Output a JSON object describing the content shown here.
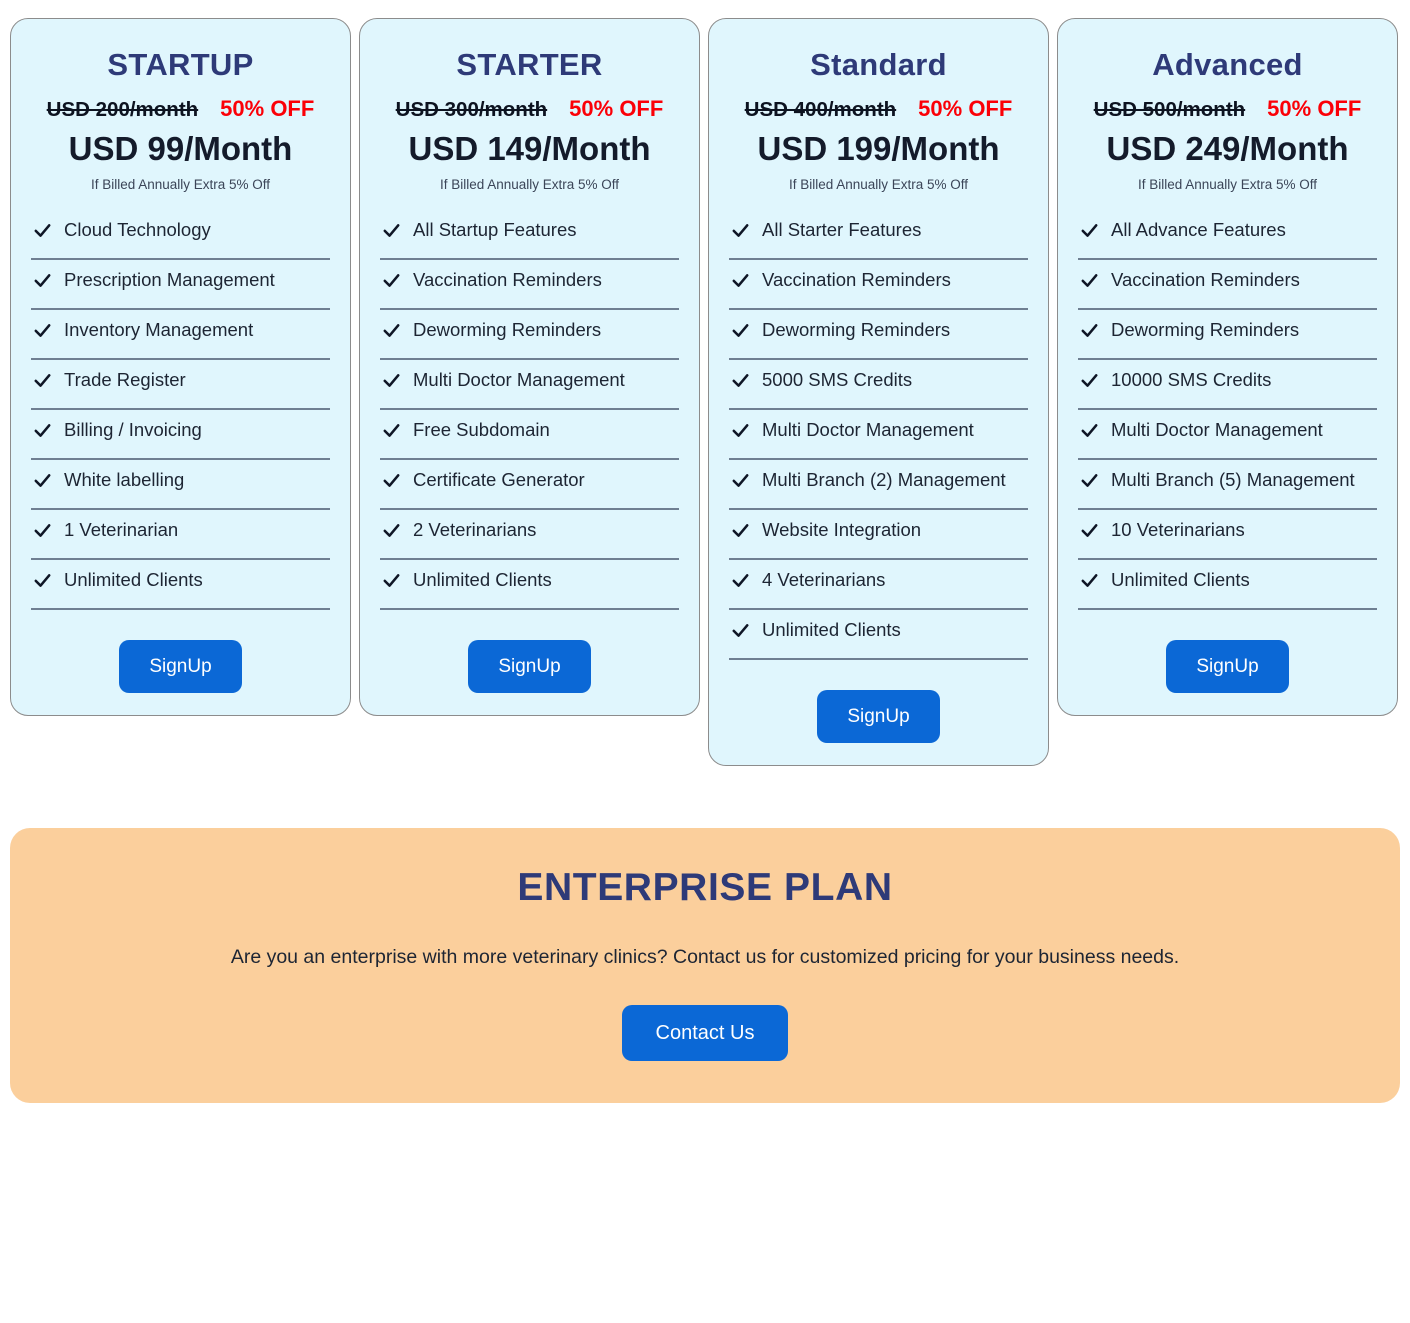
{
  "colors": {
    "card_background": "#e0f6fd",
    "card_border": "#8c8c8c",
    "plan_title": "#2e3a78",
    "discount_red": "#fb0007",
    "button_blue": "#0b68d6",
    "banner_peach": "#fbcf9c",
    "divider": "#6f7f92"
  },
  "plans": [
    {
      "title": "STARTUP",
      "old_price": "USD 200/month",
      "discount": "50% OFF",
      "current_price": "USD 99/Month",
      "billing_note": "If Billed Annually Extra 5% Off",
      "signup_label": "SignUp",
      "features": [
        "Cloud Technology",
        "Prescription Management",
        "Inventory Management",
        "Trade Register",
        "Billing / Invoicing",
        "White labelling",
        "1 Veterinarian",
        "Unlimited Clients"
      ]
    },
    {
      "title": "STARTER",
      "old_price": "USD 300/month",
      "discount": "50% OFF",
      "current_price": "USD 149/Month",
      "billing_note": "If Billed Annually Extra 5% Off",
      "signup_label": "SignUp",
      "features": [
        "All Startup Features",
        "Vaccination Reminders",
        "Deworming Reminders",
        "Multi Doctor Management",
        "Free Subdomain",
        "Certificate Generator",
        "2 Veterinarians",
        "Unlimited Clients"
      ]
    },
    {
      "title": "Standard",
      "old_price": "USD 400/month",
      "discount": "50% OFF",
      "current_price": "USD 199/Month",
      "billing_note": "If Billed Annually Extra 5% Off",
      "signup_label": "SignUp",
      "features": [
        "All Starter Features",
        "Vaccination Reminders",
        "Deworming Reminders",
        "5000 SMS Credits",
        "Multi Doctor Management",
        "Multi Branch (2) Management",
        "Website Integration",
        "4 Veterinarians",
        "Unlimited Clients"
      ]
    },
    {
      "title": "Advanced",
      "old_price": "USD 500/month",
      "discount": "50% OFF",
      "current_price": "USD 249/Month",
      "billing_note": "If Billed Annually Extra 5% Off",
      "signup_label": "SignUp",
      "features": [
        "All Advance Features",
        "Vaccination Reminders",
        "Deworming Reminders",
        "10000 SMS Credits",
        "Multi Doctor Management",
        "Multi Branch (5) Management",
        "10 Veterinarians",
        "Unlimited Clients"
      ]
    }
  ],
  "enterprise": {
    "title": "ENTERPRISE PLAN",
    "description": "Are you an enterprise with more veterinary clinics? Contact us for customized pricing for your business needs.",
    "contact_label": "Contact Us"
  }
}
